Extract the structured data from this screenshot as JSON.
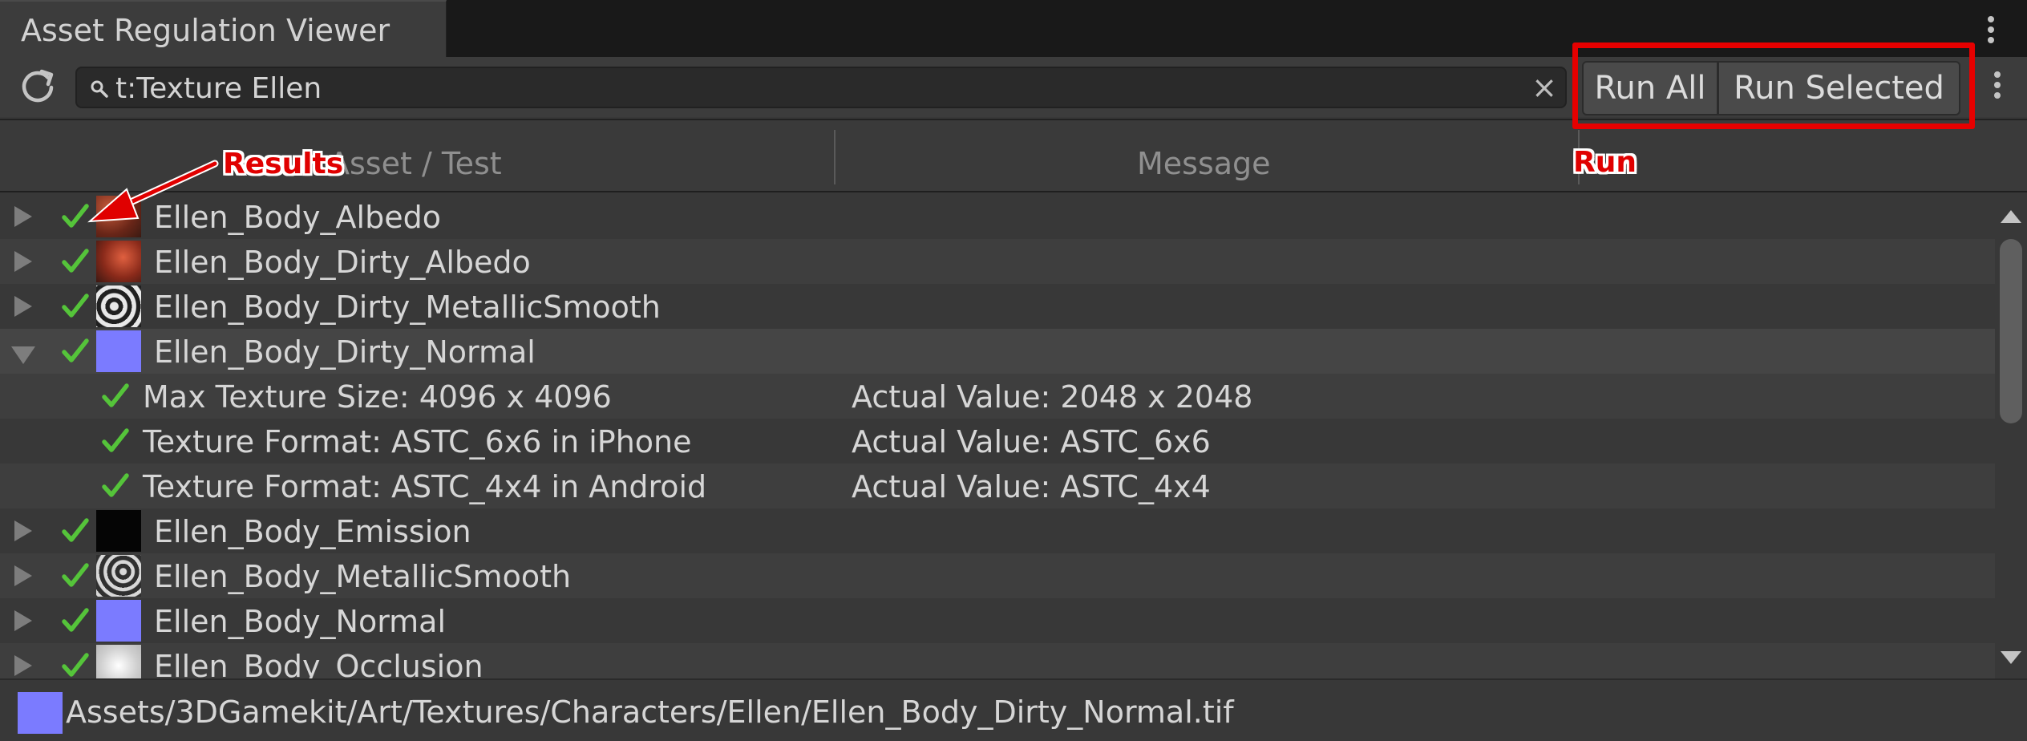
{
  "window": {
    "tab_title": "Asset Regulation Viewer"
  },
  "toolbar": {
    "search_value": "t:Texture Ellen",
    "clear_glyph": "×",
    "run_all_label": "Run All",
    "run_selected_label": "Run Selected"
  },
  "columns": {
    "asset_test": "Asset / Test",
    "message": "Message"
  },
  "rows": [
    {
      "label": "Ellen_Body_Albedo",
      "status": "pass",
      "thumb": "albedo-red",
      "expanded": false
    },
    {
      "label": "Ellen_Body_Dirty_Albedo",
      "status": "pass",
      "thumb": "albedo-red-dirty",
      "expanded": false
    },
    {
      "label": "Ellen_Body_Dirty_MetallicSmooth",
      "status": "pass",
      "thumb": "noise-bw",
      "expanded": false
    },
    {
      "label": "Ellen_Body_Dirty_Normal",
      "status": "pass",
      "thumb": "normal-blue",
      "expanded": true
    },
    {
      "label": "Ellen_Body_Emission",
      "status": "pass",
      "thumb": "black",
      "expanded": false
    },
    {
      "label": "Ellen_Body_MetallicSmooth",
      "status": "pass",
      "thumb": "noise-bw",
      "expanded": false
    },
    {
      "label": "Ellen_Body_Normal",
      "status": "pass",
      "thumb": "normal-blue",
      "expanded": false
    },
    {
      "label": "Ellen_Body_Occlusion",
      "status": "pass",
      "thumb": "white",
      "expanded": false
    }
  ],
  "tests": [
    {
      "label": "Max Texture Size: 4096 x 4096",
      "message": "Actual Value: 2048 x 2048",
      "status": "pass"
    },
    {
      "label": "Texture Format: ASTC_6x6 in iPhone",
      "message": "Actual Value: ASTC_6x6",
      "status": "pass"
    },
    {
      "label": "Texture Format: ASTC_4x4 in Android",
      "message": "Actual Value: ASTC_4x4",
      "status": "pass"
    }
  ],
  "footer": {
    "path": "Assets/3DGamekit/Art/Textures/Characters/Ellen/Ellen_Body_Dirty_Normal.tif"
  },
  "annotations": {
    "results": "Results",
    "run": "Run"
  },
  "colors": {
    "pass_check": "#55c43a",
    "annotation_red": "#e00000",
    "normal_map_blue": "#7b7bff"
  }
}
